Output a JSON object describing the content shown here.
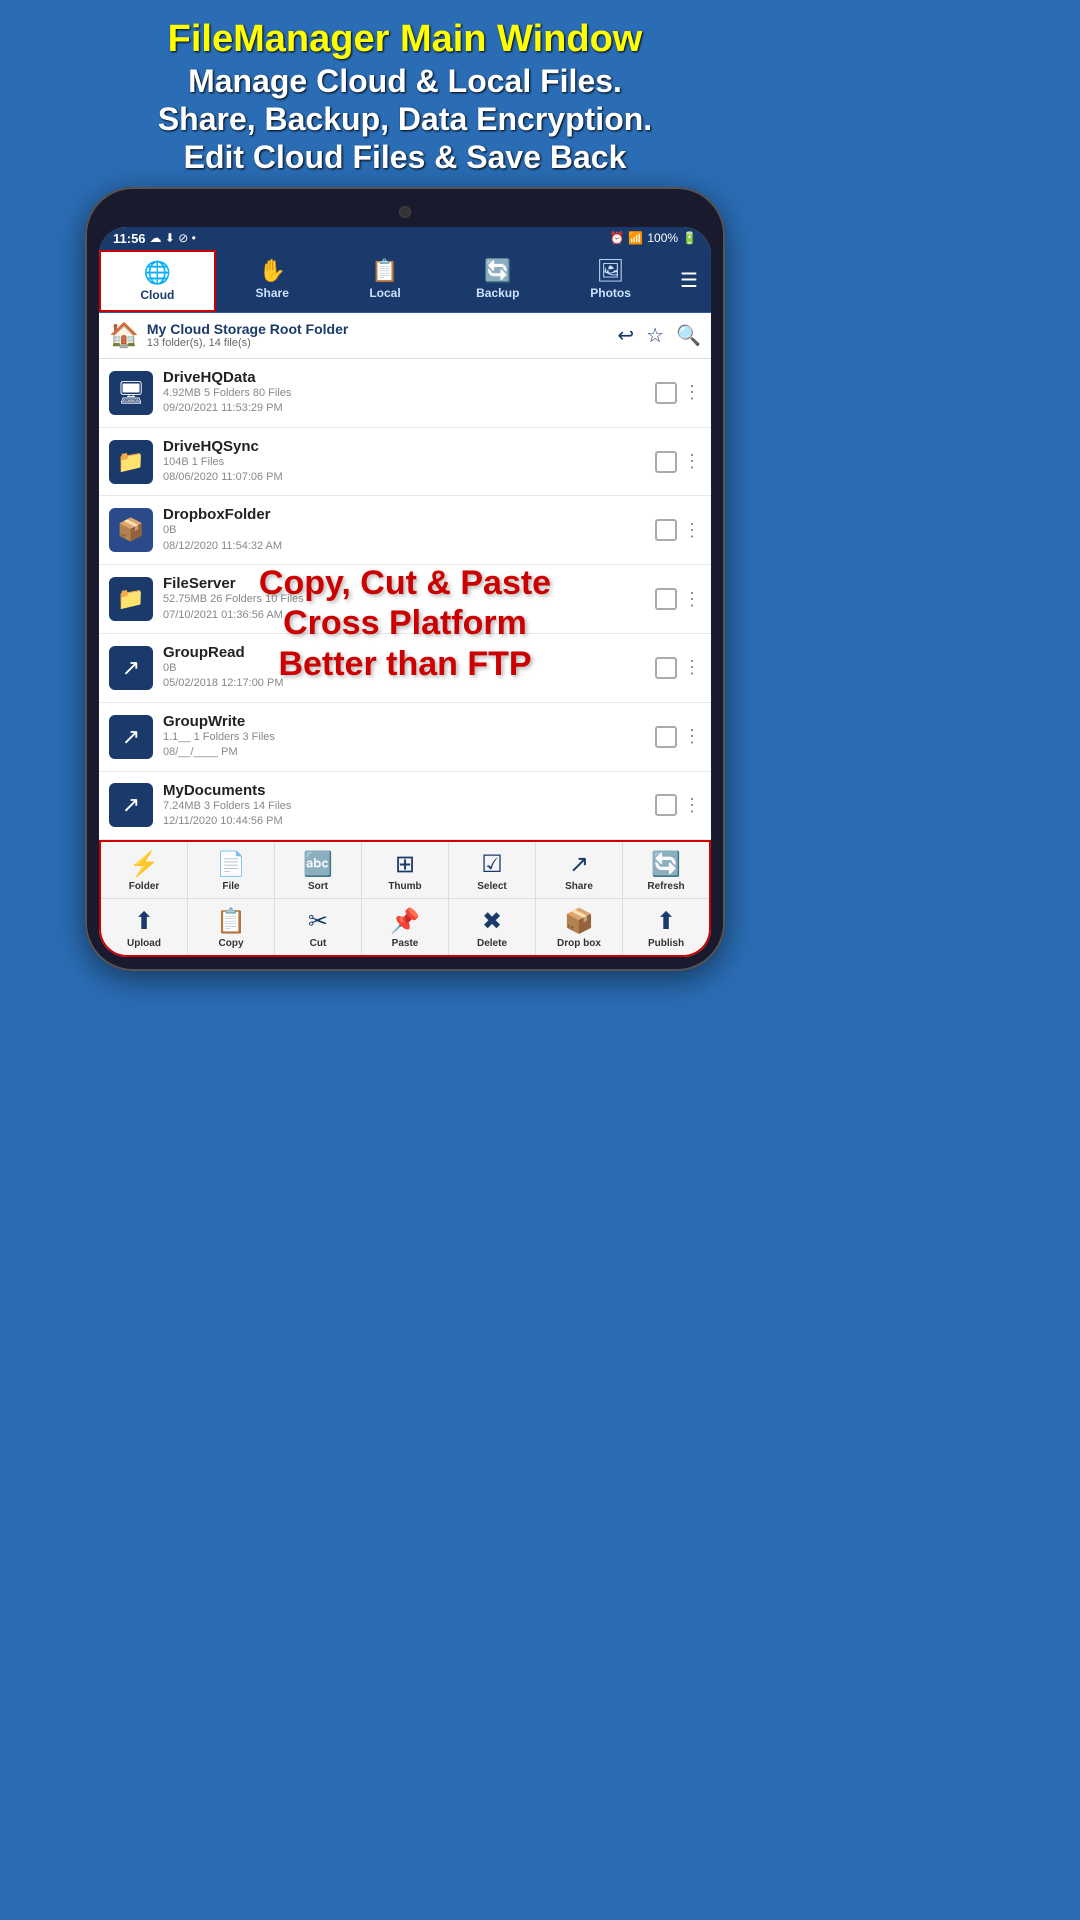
{
  "header": {
    "title": "FileManager Main Window",
    "subtitle1": "Manage Cloud & Local Files.",
    "subtitle2": "Share, Backup, Data Encryption.",
    "subtitle3": "Edit Cloud Files & Save Back"
  },
  "status_bar": {
    "time": "11:56",
    "battery": "100%",
    "icons": "☁ ⬇ ⊘ •"
  },
  "nav_tabs": [
    {
      "id": "cloud",
      "label": "Cloud",
      "icon": "🌐",
      "active": true
    },
    {
      "id": "share",
      "label": "Share",
      "icon": "✋",
      "active": false
    },
    {
      "id": "local",
      "label": "Local",
      "icon": "📋",
      "active": false
    },
    {
      "id": "backup",
      "label": "Backup",
      "icon": "🔄",
      "active": false
    },
    {
      "id": "photos",
      "label": "Photos",
      "icon": "🖼",
      "active": false
    }
  ],
  "folder_header": {
    "name": "My Cloud Storage Root Folder",
    "count": "13 folder(s), 14 file(s)"
  },
  "files": [
    {
      "name": "DriveHQData",
      "meta1": "4.92MB 5 Folders  80 Files",
      "meta2": "09/20/2021 11:53:29 PM",
      "icon": "desktop"
    },
    {
      "name": "DriveHQSync",
      "meta1": "104B 1 Files",
      "meta2": "08/06/2020 11:07:06 PM",
      "icon": "folder"
    },
    {
      "name": "DropboxFolder",
      "meta1": "0B",
      "meta2": "08/12/2020 11:54:32 AM",
      "icon": "dropbox"
    },
    {
      "name": "FileServer",
      "meta1": "52.75MB 26 Folders  10 Files",
      "meta2": "07/10/2021 01:36:56 AM",
      "icon": "folder"
    },
    {
      "name": "GroupRead",
      "meta1": "0B",
      "meta2": "05/02/2018 12:17:00 PM",
      "icon": "share"
    },
    {
      "name": "GroupWrite",
      "meta1": "1.1__ 1 Folders  3 Files",
      "meta2": "08/__/____ PM",
      "icon": "share"
    },
    {
      "name": "MyDocuments",
      "meta1": "7.24MB 3 Folders  14 Files",
      "meta2": "12/11/2020 10:44:56 PM",
      "icon": "share"
    }
  ],
  "overlay": {
    "line1": "Copy, Cut & Paste",
    "line2": "Cross Platform",
    "line3": "Better than FTP"
  },
  "toolbar_row1": [
    {
      "id": "folder",
      "label": "Folder",
      "icon": "⚡"
    },
    {
      "id": "file",
      "label": "File",
      "icon": "📄"
    },
    {
      "id": "sort",
      "label": "Sort",
      "icon": "🔤"
    },
    {
      "id": "thumb",
      "label": "Thumb",
      "icon": "⊞"
    },
    {
      "id": "select",
      "label": "Select",
      "icon": "☑"
    },
    {
      "id": "share",
      "label": "Share",
      "icon": "↗"
    },
    {
      "id": "refresh",
      "label": "Refresh",
      "icon": "🔄"
    }
  ],
  "toolbar_row2": [
    {
      "id": "upload",
      "label": "Upload",
      "icon": "⬆"
    },
    {
      "id": "copy",
      "label": "Copy",
      "icon": "📋"
    },
    {
      "id": "cut",
      "label": "Cut",
      "icon": "✂"
    },
    {
      "id": "paste",
      "label": "Paste",
      "icon": "📌"
    },
    {
      "id": "delete",
      "label": "Delete",
      "icon": "✖"
    },
    {
      "id": "dropbox",
      "label": "Drop box",
      "icon": "📦"
    },
    {
      "id": "publish",
      "label": "Publish",
      "icon": "⬆"
    }
  ]
}
